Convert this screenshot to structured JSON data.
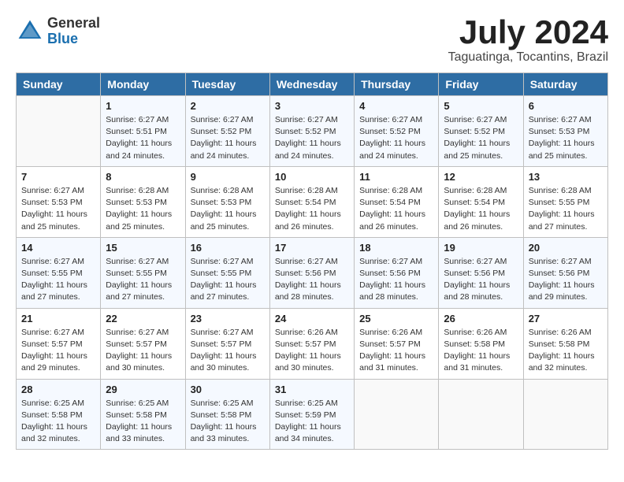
{
  "logo": {
    "general": "General",
    "blue": "Blue"
  },
  "title": "July 2024",
  "location": "Taguatinga, Tocantins, Brazil",
  "days_of_week": [
    "Sunday",
    "Monday",
    "Tuesday",
    "Wednesday",
    "Thursday",
    "Friday",
    "Saturday"
  ],
  "weeks": [
    [
      {
        "day": "",
        "content": ""
      },
      {
        "day": "1",
        "content": "Sunrise: 6:27 AM\nSunset: 5:51 PM\nDaylight: 11 hours\nand 24 minutes."
      },
      {
        "day": "2",
        "content": "Sunrise: 6:27 AM\nSunset: 5:52 PM\nDaylight: 11 hours\nand 24 minutes."
      },
      {
        "day": "3",
        "content": "Sunrise: 6:27 AM\nSunset: 5:52 PM\nDaylight: 11 hours\nand 24 minutes."
      },
      {
        "day": "4",
        "content": "Sunrise: 6:27 AM\nSunset: 5:52 PM\nDaylight: 11 hours\nand 24 minutes."
      },
      {
        "day": "5",
        "content": "Sunrise: 6:27 AM\nSunset: 5:52 PM\nDaylight: 11 hours\nand 25 minutes."
      },
      {
        "day": "6",
        "content": "Sunrise: 6:27 AM\nSunset: 5:53 PM\nDaylight: 11 hours\nand 25 minutes."
      }
    ],
    [
      {
        "day": "7",
        "content": "Sunrise: 6:27 AM\nSunset: 5:53 PM\nDaylight: 11 hours\nand 25 minutes."
      },
      {
        "day": "8",
        "content": "Sunrise: 6:28 AM\nSunset: 5:53 PM\nDaylight: 11 hours\nand 25 minutes."
      },
      {
        "day": "9",
        "content": "Sunrise: 6:28 AM\nSunset: 5:53 PM\nDaylight: 11 hours\nand 25 minutes."
      },
      {
        "day": "10",
        "content": "Sunrise: 6:28 AM\nSunset: 5:54 PM\nDaylight: 11 hours\nand 26 minutes."
      },
      {
        "day": "11",
        "content": "Sunrise: 6:28 AM\nSunset: 5:54 PM\nDaylight: 11 hours\nand 26 minutes."
      },
      {
        "day": "12",
        "content": "Sunrise: 6:28 AM\nSunset: 5:54 PM\nDaylight: 11 hours\nand 26 minutes."
      },
      {
        "day": "13",
        "content": "Sunrise: 6:28 AM\nSunset: 5:55 PM\nDaylight: 11 hours\nand 27 minutes."
      }
    ],
    [
      {
        "day": "14",
        "content": "Sunrise: 6:27 AM\nSunset: 5:55 PM\nDaylight: 11 hours\nand 27 minutes."
      },
      {
        "day": "15",
        "content": "Sunrise: 6:27 AM\nSunset: 5:55 PM\nDaylight: 11 hours\nand 27 minutes."
      },
      {
        "day": "16",
        "content": "Sunrise: 6:27 AM\nSunset: 5:55 PM\nDaylight: 11 hours\nand 27 minutes."
      },
      {
        "day": "17",
        "content": "Sunrise: 6:27 AM\nSunset: 5:56 PM\nDaylight: 11 hours\nand 28 minutes."
      },
      {
        "day": "18",
        "content": "Sunrise: 6:27 AM\nSunset: 5:56 PM\nDaylight: 11 hours\nand 28 minutes."
      },
      {
        "day": "19",
        "content": "Sunrise: 6:27 AM\nSunset: 5:56 PM\nDaylight: 11 hours\nand 28 minutes."
      },
      {
        "day": "20",
        "content": "Sunrise: 6:27 AM\nSunset: 5:56 PM\nDaylight: 11 hours\nand 29 minutes."
      }
    ],
    [
      {
        "day": "21",
        "content": "Sunrise: 6:27 AM\nSunset: 5:57 PM\nDaylight: 11 hours\nand 29 minutes."
      },
      {
        "day": "22",
        "content": "Sunrise: 6:27 AM\nSunset: 5:57 PM\nDaylight: 11 hours\nand 30 minutes."
      },
      {
        "day": "23",
        "content": "Sunrise: 6:27 AM\nSunset: 5:57 PM\nDaylight: 11 hours\nand 30 minutes."
      },
      {
        "day": "24",
        "content": "Sunrise: 6:26 AM\nSunset: 5:57 PM\nDaylight: 11 hours\nand 30 minutes."
      },
      {
        "day": "25",
        "content": "Sunrise: 6:26 AM\nSunset: 5:57 PM\nDaylight: 11 hours\nand 31 minutes."
      },
      {
        "day": "26",
        "content": "Sunrise: 6:26 AM\nSunset: 5:58 PM\nDaylight: 11 hours\nand 31 minutes."
      },
      {
        "day": "27",
        "content": "Sunrise: 6:26 AM\nSunset: 5:58 PM\nDaylight: 11 hours\nand 32 minutes."
      }
    ],
    [
      {
        "day": "28",
        "content": "Sunrise: 6:25 AM\nSunset: 5:58 PM\nDaylight: 11 hours\nand 32 minutes."
      },
      {
        "day": "29",
        "content": "Sunrise: 6:25 AM\nSunset: 5:58 PM\nDaylight: 11 hours\nand 33 minutes."
      },
      {
        "day": "30",
        "content": "Sunrise: 6:25 AM\nSunset: 5:58 PM\nDaylight: 11 hours\nand 33 minutes."
      },
      {
        "day": "31",
        "content": "Sunrise: 6:25 AM\nSunset: 5:59 PM\nDaylight: 11 hours\nand 34 minutes."
      },
      {
        "day": "",
        "content": ""
      },
      {
        "day": "",
        "content": ""
      },
      {
        "day": "",
        "content": ""
      }
    ]
  ]
}
